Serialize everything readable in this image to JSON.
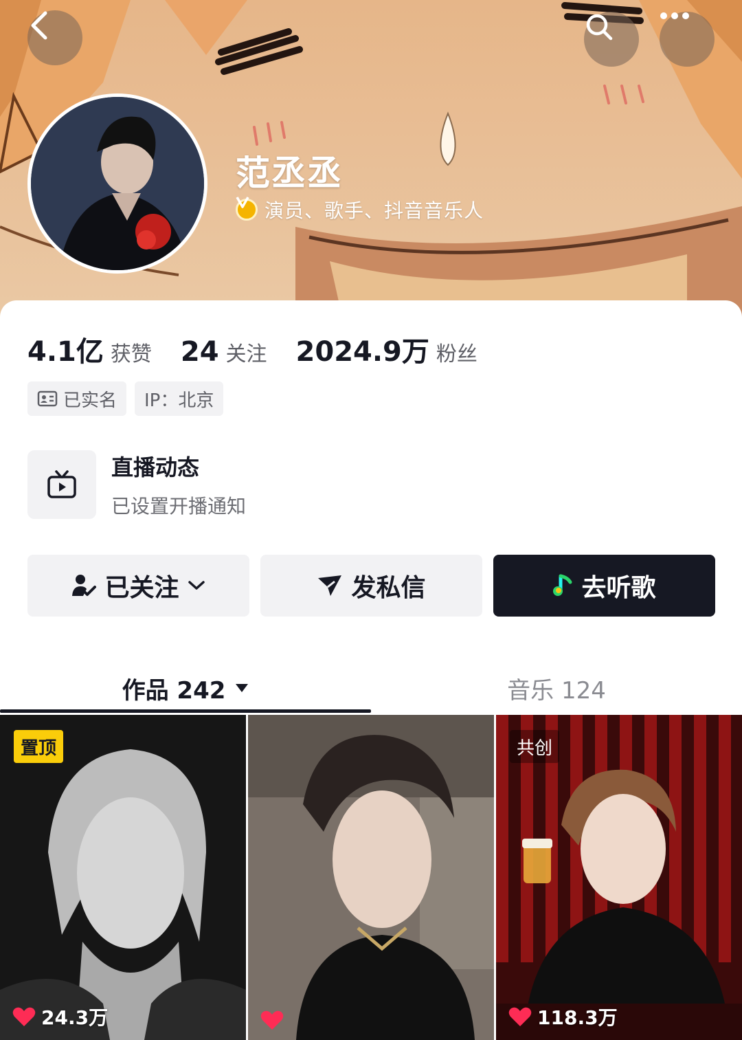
{
  "header": {
    "name": "范丞丞",
    "verification": "演员、歌手、抖音音乐人"
  },
  "stats": [
    {
      "value": "4.1亿",
      "label": "获赞"
    },
    {
      "value": "24",
      "label": "关注"
    },
    {
      "value": "2024.9万",
      "label": "粉丝"
    }
  ],
  "tags": {
    "verified_name": "已实名",
    "ip": "IP：北京"
  },
  "live": {
    "title": "直播动态",
    "subtitle": "已设置开播通知"
  },
  "actions": {
    "follow": "已关注",
    "message": "发私信",
    "music": "去听歌"
  },
  "tabs": {
    "works": "作品 242",
    "music": "音乐 124"
  },
  "videos": [
    {
      "badge": "置顶",
      "likes": "24.3万"
    },
    {
      "badge": "",
      "likes": ""
    },
    {
      "badge": "共创",
      "likes": "118.3万"
    }
  ],
  "colors": {
    "primary_text": "#161823",
    "verify_badge": "#f5b400",
    "pin_badge": "#facd0a",
    "like_heart": "#fe2c55"
  }
}
